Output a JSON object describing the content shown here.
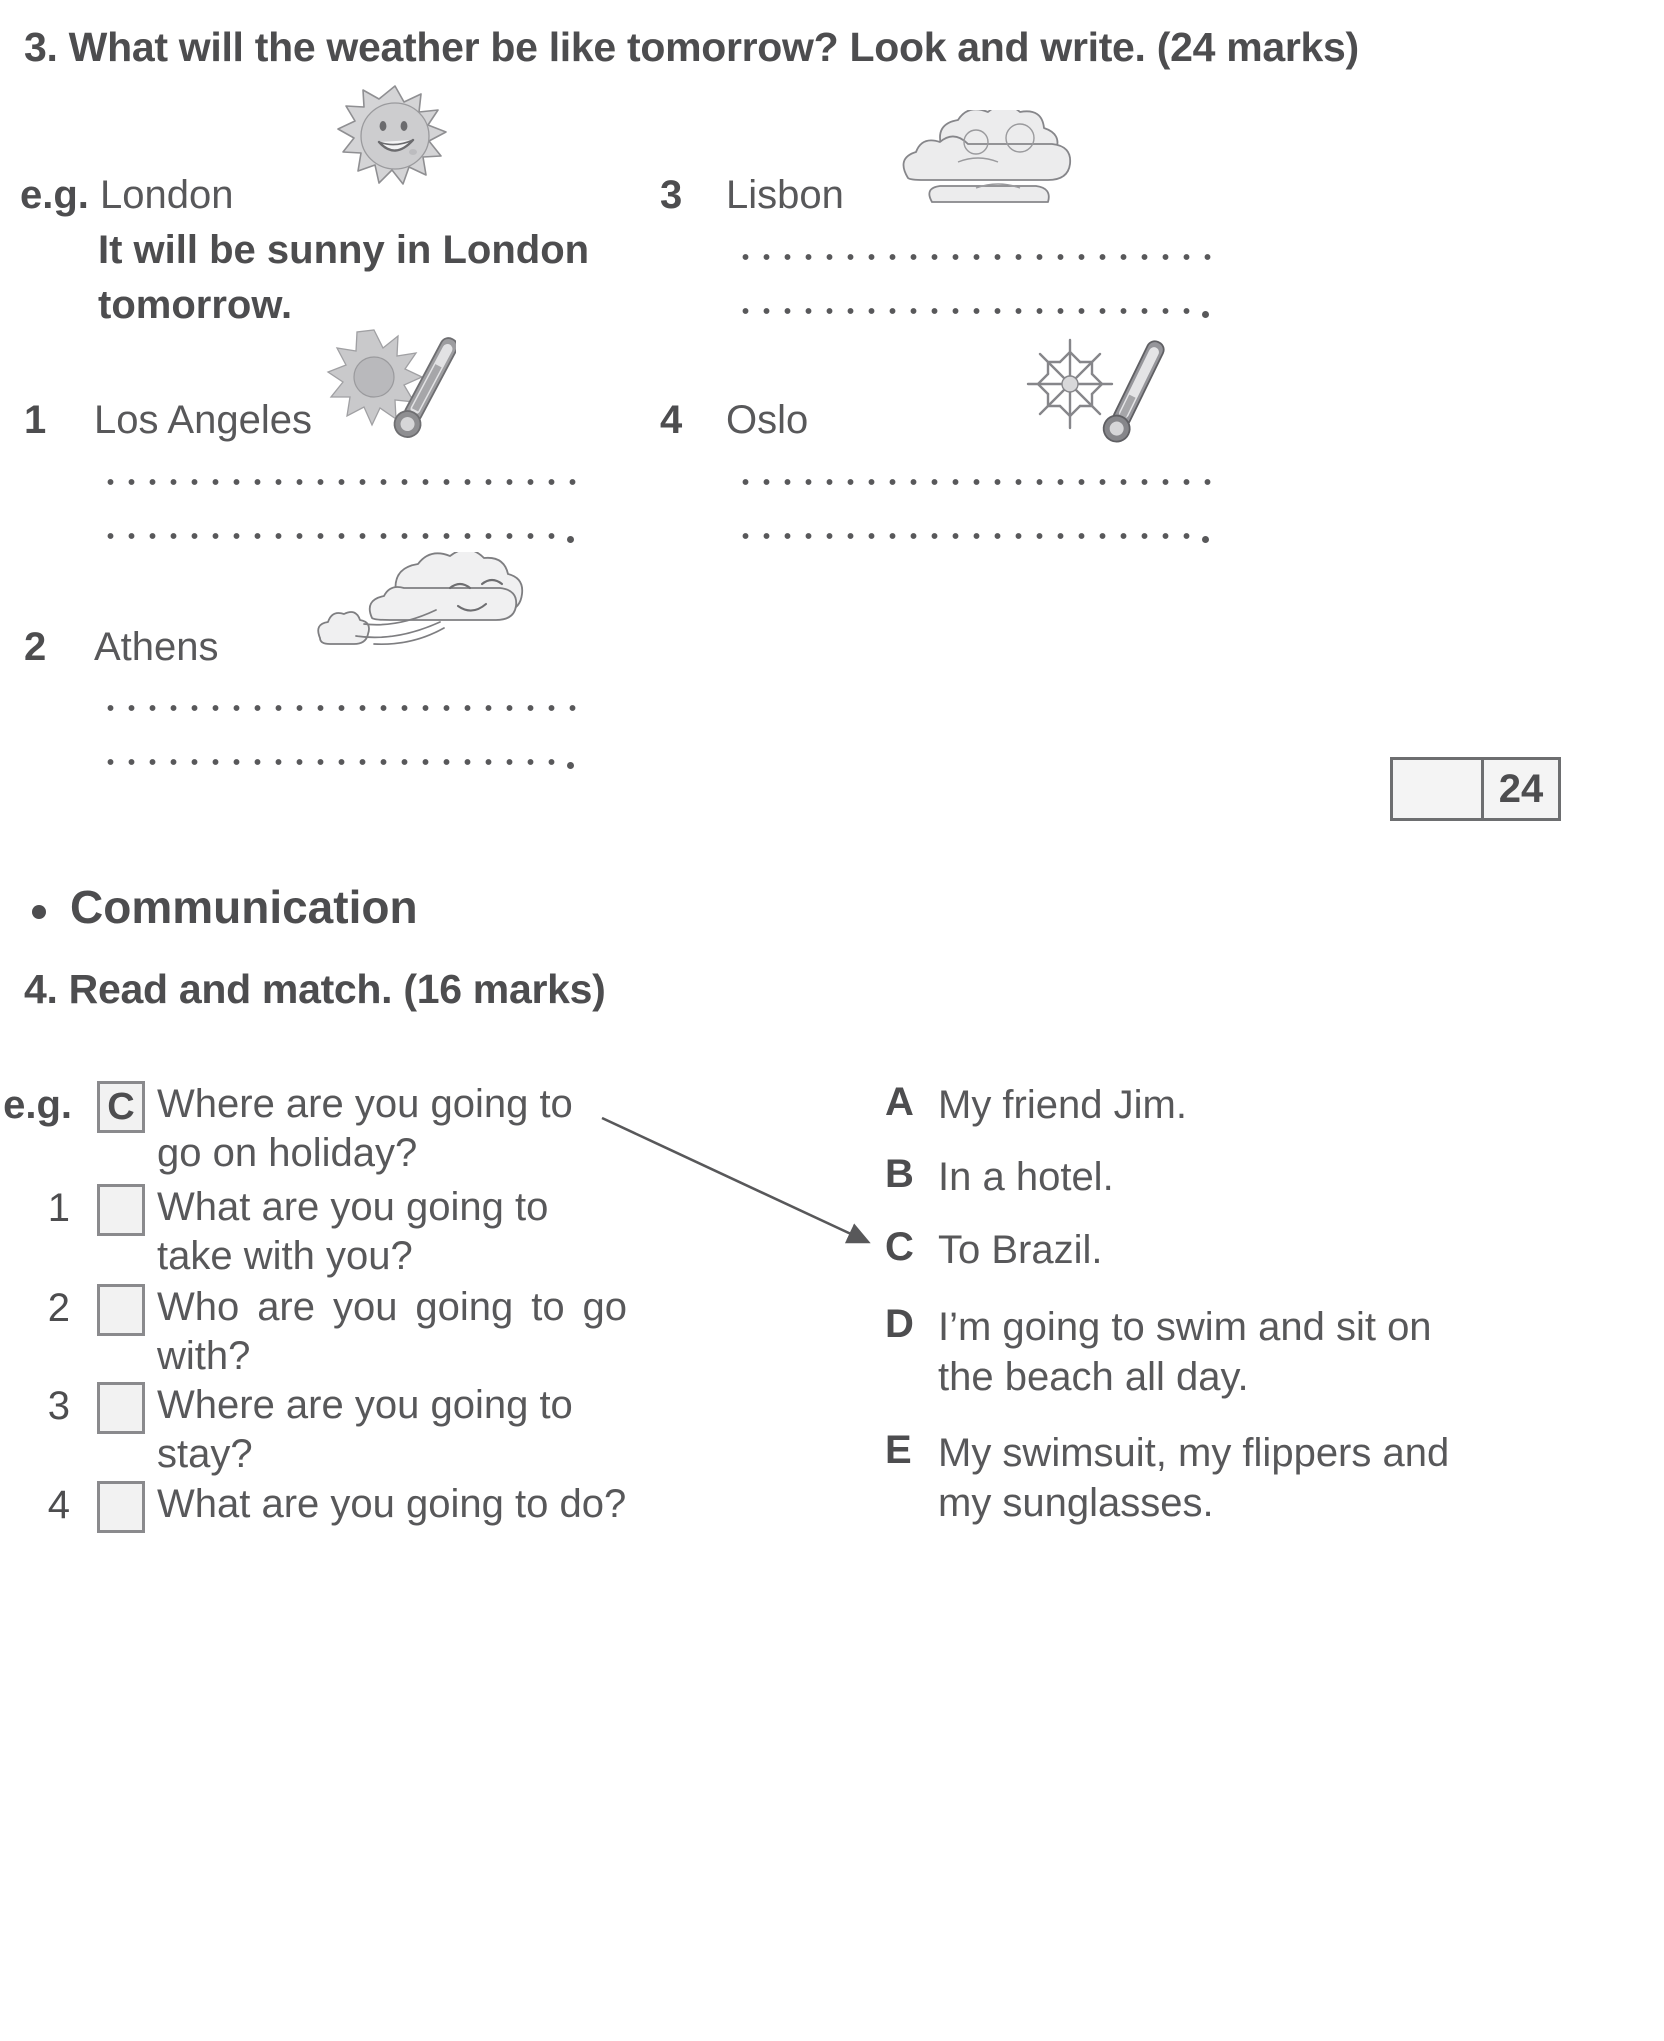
{
  "exercise3": {
    "heading": "3. What will the weather be like tomorrow? Look and write. (24 marks)",
    "example_label": "e.g.",
    "example_city": "London",
    "example_answer_line1": "It will be sunny in London",
    "example_answer_line2": "tomorrow.",
    "example_icon": "sun-smiling-icon",
    "items": [
      {
        "number": "1",
        "city": "Los Angeles",
        "icon": "sun-thermometer-hot-icon"
      },
      {
        "number": "2",
        "city": "Athens",
        "icon": "cloud-windy-icon"
      },
      {
        "number": "3",
        "city": "Lisbon",
        "icon": "clouds-cloudy-icon"
      },
      {
        "number": "4",
        "city": "Oslo",
        "icon": "snowflake-thermometer-cold-icon"
      }
    ],
    "marks_box": {
      "blank": "",
      "value": "24"
    }
  },
  "section": {
    "bullet_title": "Communication"
  },
  "exercise4": {
    "heading": "4. Read and match. (16 marks)",
    "example_label": "e.g.",
    "example_answer_letter": "C",
    "questions": [
      {
        "number": "e.g.",
        "box": "C",
        "text": "Where are you going to go on holiday?"
      },
      {
        "number": "1",
        "box": "",
        "text": "What are you going to take with you?"
      },
      {
        "number": "2",
        "box": "",
        "text": "Who are you going to go with?"
      },
      {
        "number": "3",
        "box": "",
        "text": "Where are you going to stay?"
      },
      {
        "number": "4",
        "box": "",
        "text": "What are you going to do?"
      }
    ],
    "answers": [
      {
        "letter": "A",
        "text": "My friend Jim."
      },
      {
        "letter": "B",
        "text": "In a hotel."
      },
      {
        "letter": "C",
        "text": "To Brazil."
      },
      {
        "letter": "D",
        "text": "I’m going to swim and sit on the beach all day."
      },
      {
        "letter": "E",
        "text": "My swimsuit, my flippers and my sunglasses."
      }
    ]
  },
  "colors": {
    "ink": "#58585a",
    "ink_dark": "#4d4d4f",
    "box_border": "#8a8a8d",
    "paper": "#ffffff"
  }
}
